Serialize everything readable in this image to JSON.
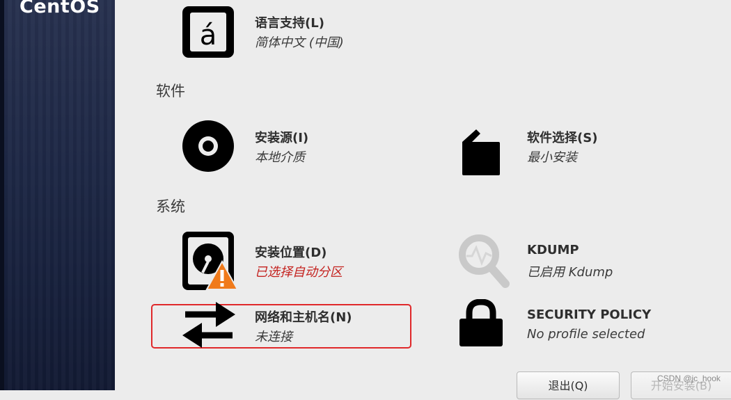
{
  "sidebar": {
    "logo": "CentOS"
  },
  "sections": {
    "software": "软件",
    "system": "系统"
  },
  "spokes": {
    "language": {
      "title": "语言支持(L)",
      "status": "简体中文 (中国)",
      "icon": "language-icon"
    },
    "install_source": {
      "title": "安装源(I)",
      "status": "本地介质",
      "icon": "disc-icon"
    },
    "software_selection": {
      "title": "软件选择(S)",
      "status": "最小安装",
      "icon": "package-icon"
    },
    "install_destination": {
      "title": "安装位置(D)",
      "status": "已选择自动分区",
      "icon": "disk-warning-icon",
      "status_color": "#c4221f"
    },
    "kdump": {
      "title": "KDUMP",
      "status": "已启用 Kdump",
      "icon": "magnifier-icon"
    },
    "network": {
      "title": "网络和主机名(N)",
      "status": "未连接",
      "icon": "network-arrows-icon"
    },
    "security": {
      "title": "SECURITY POLICY",
      "status": "No profile selected",
      "icon": "lock-icon"
    }
  },
  "buttons": {
    "quit": "退出(Q)",
    "begin": "开始安装(B)"
  },
  "watermark": "CSDN @jc_hook",
  "colors": {
    "highlight": "#e0282a",
    "warning": "#f07a1a"
  }
}
